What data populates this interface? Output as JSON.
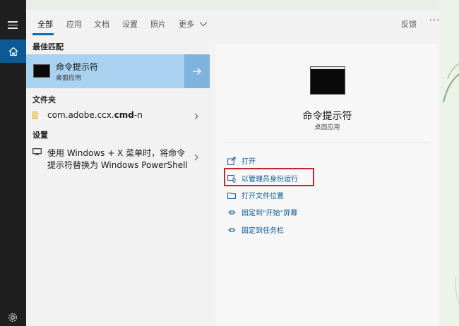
{
  "tabs": [
    {
      "label": "全部"
    },
    {
      "label": "应用"
    },
    {
      "label": "文档"
    },
    {
      "label": "设置"
    },
    {
      "label": "照片"
    },
    {
      "label": "更多"
    }
  ],
  "header": {
    "feedback": "反馈",
    "more": "···"
  },
  "results": {
    "best_match_title": "最佳匹配",
    "best_match": {
      "name": "命令提示符",
      "subtitle": "桌面应用"
    },
    "folders_title": "文件夹",
    "folder_item": {
      "prefix": "com.adobe.ccx.",
      "bold": "cmd",
      "suffix": "-n"
    },
    "settings_title": "设置",
    "settings_item": {
      "line1": "使用 Windows + X 菜单时，将命令",
      "line2": "提示符替换为 Windows PowerShell"
    }
  },
  "detail": {
    "title": "命令提示符",
    "subtitle": "桌面应用",
    "actions": [
      {
        "label": "打开",
        "icon": "open-icon"
      },
      {
        "label": "以管理员身份运行",
        "icon": "shield-run-icon"
      },
      {
        "label": "打开文件位置",
        "icon": "folder-location-icon"
      },
      {
        "label": "固定到\"开始\"屏幕",
        "icon": "pin-icon"
      },
      {
        "label": "固定到任务栏",
        "icon": "pin-icon"
      }
    ]
  },
  "colors": {
    "accent": "#0b6bbf",
    "highlight": "#a9d2f0",
    "rail": "#1f1f1f",
    "annotation": "#c4262e"
  }
}
